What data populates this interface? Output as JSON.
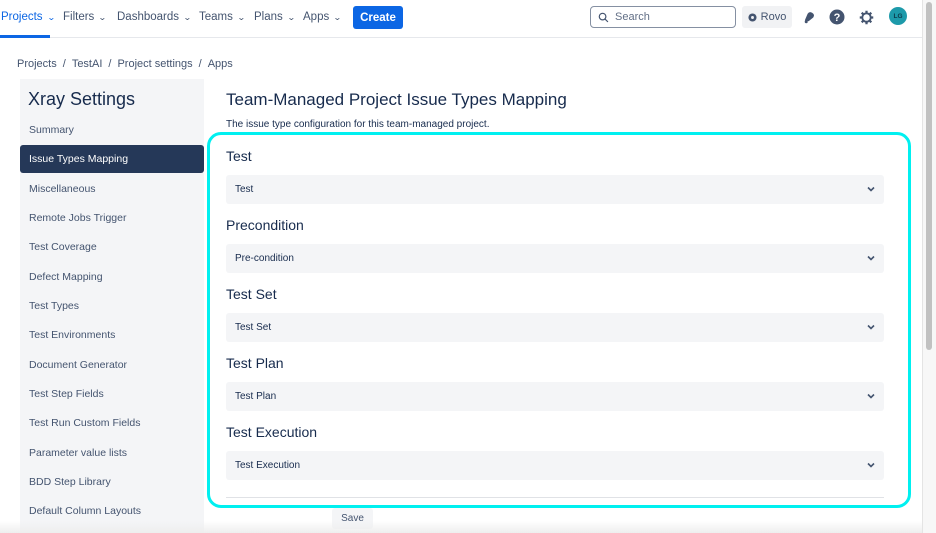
{
  "topnav": {
    "items": [
      {
        "label": "Projects",
        "active": true
      },
      {
        "label": "Filters",
        "active": false
      },
      {
        "label": "Dashboards",
        "active": false
      },
      {
        "label": "Teams",
        "active": false
      },
      {
        "label": "Plans",
        "active": false
      },
      {
        "label": "Apps",
        "active": false
      }
    ],
    "create_label": "Create",
    "search_placeholder": "Search",
    "rovo_label": "Rovo",
    "avatar_initials": "LG",
    "icons": [
      "notifications-icon",
      "help-icon",
      "settings-icon"
    ]
  },
  "breadcrumb": [
    "Projects",
    "TestAI",
    "Project settings",
    "Apps"
  ],
  "sidebar": {
    "title": "Xray Settings",
    "items": [
      {
        "label": "Summary"
      },
      {
        "label": "Issue Types Mapping",
        "active": true
      },
      {
        "label": "Miscellaneous"
      },
      {
        "label": "Remote Jobs Trigger"
      },
      {
        "label": "Test Coverage"
      },
      {
        "label": "Defect Mapping"
      },
      {
        "label": "Test Types"
      },
      {
        "label": "Test Environments"
      },
      {
        "label": "Document Generator"
      },
      {
        "label": "Test Step Fields"
      },
      {
        "label": "Test Run Custom Fields"
      },
      {
        "label": "Parameter value lists"
      },
      {
        "label": "BDD Step Library"
      },
      {
        "label": "Default Column Layouts"
      }
    ]
  },
  "main": {
    "title": "Team-Managed Project Issue Types Mapping",
    "description": "The issue type configuration for this team-managed project.",
    "mappings": [
      {
        "label": "Test",
        "value": "Test"
      },
      {
        "label": "Precondition",
        "value": "Pre-condition"
      },
      {
        "label": "Test Set",
        "value": "Test Set"
      },
      {
        "label": "Test Plan",
        "value": "Test Plan"
      },
      {
        "label": "Test Execution",
        "value": "Test Execution"
      }
    ],
    "save_label": "Save"
  },
  "colors": {
    "accent": "#0c66e4",
    "sidebar_active": "#253858",
    "highlight": "#00f0f0",
    "avatar": "#1d9aaa"
  }
}
